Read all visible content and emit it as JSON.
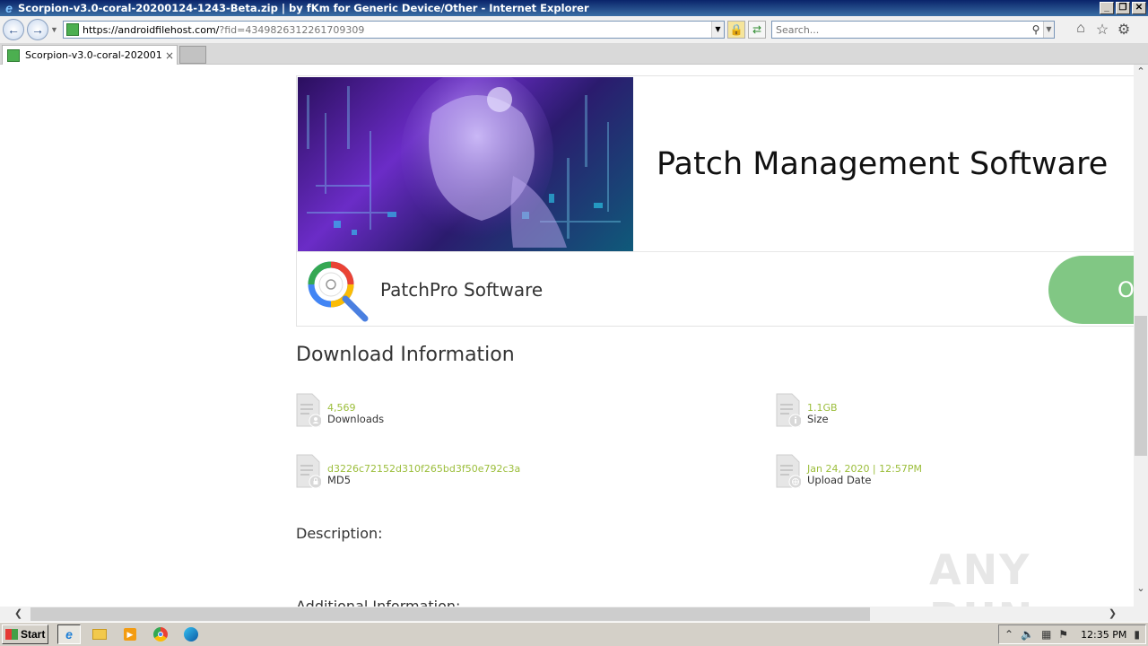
{
  "window": {
    "title": "Scorpion-v3.0-coral-20200124-1243-Beta.zip | by fKm for Generic Device/Other - Internet Explorer",
    "min": "_",
    "restore": "❐",
    "close": "✕"
  },
  "navbar": {
    "url_host": "https://androidfilehost.com/",
    "url_path": "?fid=4349826312261709309",
    "search_placeholder": "Search..."
  },
  "tabs": [
    {
      "label": "Scorpion-v3.0-coral-202001...",
      "close": "×"
    }
  ],
  "ad": {
    "headline": "Patch Management Software",
    "brand": "PatchPro Software",
    "button": "Open"
  },
  "download_info": {
    "title": "Download Information",
    "items": [
      {
        "value": "4,569",
        "label": "Downloads",
        "icon": "person"
      },
      {
        "value": "1.1GB",
        "label": "Size",
        "icon": "info"
      },
      {
        "value": "d3226c72152d310f265bd3f50e792c3a",
        "label": "MD5",
        "icon": "lock"
      },
      {
        "value": "Jan 24, 2020 | 12:57PM",
        "label": "Upload Date",
        "icon": "globe"
      }
    ]
  },
  "description_title": "Description:",
  "additional_title": "Additional Information:",
  "watermark": "ANY RUN",
  "taskbar": {
    "start": "Start",
    "clock": "12:35 PM"
  },
  "colors": {
    "accent_value": "#9cbe3c",
    "open_button": "#81c784",
    "titlebar": "#0a246a"
  }
}
